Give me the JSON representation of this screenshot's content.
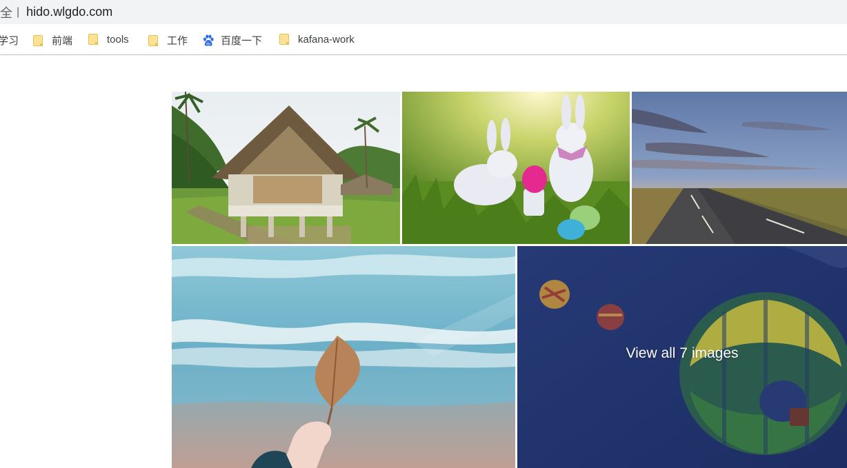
{
  "browser": {
    "address_security_text": "全",
    "address_separator": "|",
    "url": "hido.wlgdo.com"
  },
  "bookmarks": [
    {
      "label": "学习",
      "icon": "folder-icon"
    },
    {
      "label": "前端",
      "icon": "folder-icon"
    },
    {
      "label": "tools",
      "icon": "folder-icon"
    },
    {
      "label": "工作",
      "icon": "folder-icon"
    },
    {
      "label": "百度一下",
      "icon": "baidu-paw-icon"
    },
    {
      "label": "kafana-work",
      "icon": "folder-icon"
    }
  ],
  "gallery": {
    "images": [
      {
        "name": "thatched-hut"
      },
      {
        "name": "easter-bunnies"
      },
      {
        "name": "sunset-road"
      },
      {
        "name": "leaf-by-sea"
      },
      {
        "name": "hot-air-balloons"
      }
    ],
    "view_all_label": "View all 7 images",
    "colors": {
      "overlay_text": "#ffffff",
      "sky_dark": "#1f3470"
    }
  }
}
